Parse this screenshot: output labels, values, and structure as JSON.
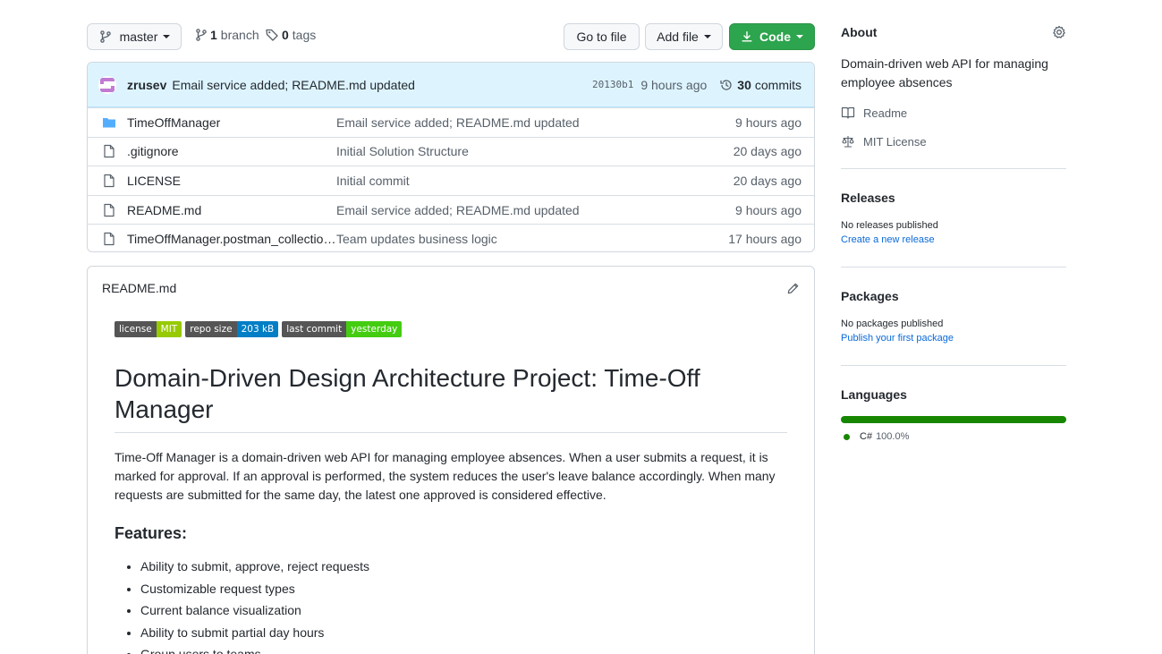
{
  "toolbar": {
    "branch_label": "master",
    "branches_count": "1",
    "branches_label": "branch",
    "tags_count": "0",
    "tags_label": "tags",
    "goto_file": "Go to file",
    "add_file": "Add file",
    "code": "Code"
  },
  "last_commit": {
    "author": "zrusev",
    "message": "Email service added; README.md updated",
    "sha": "20130b1",
    "time": "9 hours ago",
    "commits_count": "30",
    "commits_label": "commits"
  },
  "files": [
    {
      "type": "folder",
      "name": "TimeOffManager",
      "message": "Email service added; README.md updated",
      "age": "9 hours ago"
    },
    {
      "type": "file",
      "name": ".gitignore",
      "message": "Initial Solution Structure",
      "age": "20 days ago"
    },
    {
      "type": "file",
      "name": "LICENSE",
      "message": "Initial commit",
      "age": "20 days ago"
    },
    {
      "type": "file",
      "name": "README.md",
      "message": "Email service added; README.md updated",
      "age": "9 hours ago"
    },
    {
      "type": "file",
      "name": "TimeOffManager.postman_collection.j...",
      "message": "Team updates business logic",
      "age": "17 hours ago"
    }
  ],
  "readme": {
    "filename": "README.md",
    "badges": [
      {
        "label": "license",
        "value": "MIT",
        "color": "#97ca00"
      },
      {
        "label": "repo size",
        "value": "203 kB",
        "color": "#007ec6"
      },
      {
        "label": "last commit",
        "value": "yesterday",
        "color": "#4c1"
      }
    ],
    "title": "Domain-Driven Design Architecture Project: Time-Off Manager",
    "intro": "Time-Off Manager is a domain-driven web API for managing employee absences. When a user submits a request, it is marked for approval. If an approval is performed, the system reduces the user's leave balance accordingly. When many requests are submitted for the same day, the latest one approved is considered effective.",
    "features_heading": "Features:",
    "features": [
      "Ability to submit, approve, reject requests",
      "Customizable request types",
      "Current balance visualization",
      "Ability to submit partial day hours",
      "Group users to teams"
    ]
  },
  "about": {
    "heading": "About",
    "description": "Domain-driven web API for managing employee absences",
    "readme_link": "Readme",
    "license_link": "MIT License"
  },
  "releases": {
    "heading": "Releases",
    "none": "No releases published",
    "link": "Create a new release"
  },
  "packages": {
    "heading": "Packages",
    "none": "No packages published",
    "link": "Publish your first package"
  },
  "languages": {
    "heading": "Languages",
    "items": [
      {
        "name": "C#",
        "percent": "100.0%",
        "fraction": 1.0,
        "color": "#178600"
      }
    ]
  }
}
